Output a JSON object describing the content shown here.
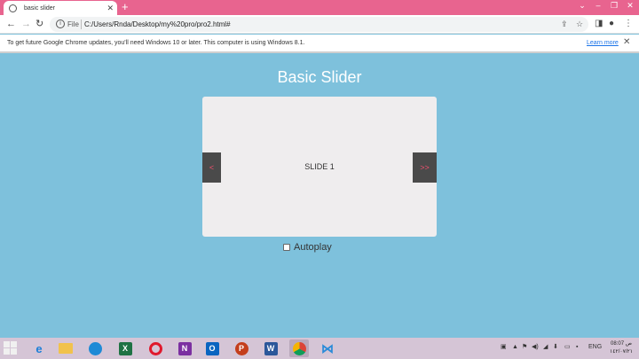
{
  "browser": {
    "tab_title": "basic slider",
    "new_tab": "+",
    "url_scheme_label": "File",
    "url": "C:/Users/Rnda/Desktop/my%20pro/pro2.html#"
  },
  "infobar": {
    "message": "To get future Google Chrome updates, you'll need Windows 10 or later. This computer is using Windows 8.1.",
    "learn_more": "Learn more"
  },
  "page": {
    "title": "Basic Slider",
    "slide_label": "SLIDE 1",
    "prev_label": "<",
    "next_label": ">>",
    "autoplay_label": "Autoplay",
    "autoplay_checked": false
  },
  "taskbar": {
    "apps": [
      "internet-explorer",
      "file-explorer",
      "edge",
      "excel",
      "opera",
      "onenote",
      "outlook",
      "powerpoint",
      "word",
      "chrome",
      "vscode"
    ],
    "active_app": "chrome",
    "language": "ENG",
    "time": "08:07 ص",
    "date": "١٤٢/٠٧/٢١"
  },
  "colors": {
    "tab_strip": "#e8648f",
    "page_background": "#7ec1dc",
    "slider_background": "#efedee",
    "arrow_background": "#4a4a4a",
    "arrow_text": "#f0506e"
  }
}
